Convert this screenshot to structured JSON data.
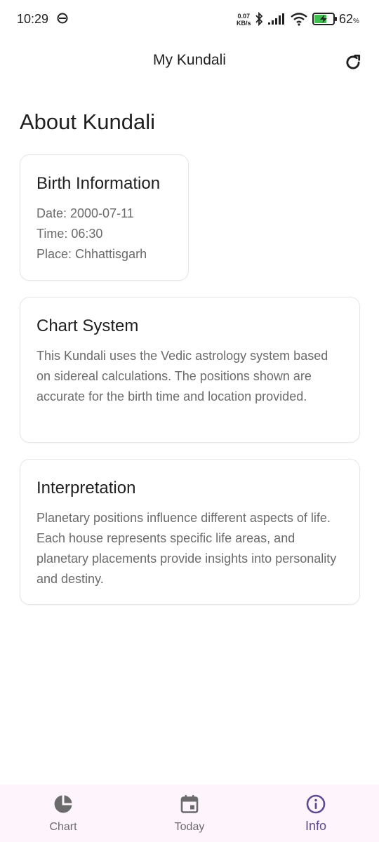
{
  "status_bar": {
    "time": "10:29",
    "net_speed_value": "0.07",
    "net_speed_unit": "KB/s",
    "battery_percent": "62",
    "battery_suffix": "%"
  },
  "app_bar": {
    "title": "My Kundali",
    "refresh_icon": "refresh-icon"
  },
  "page": {
    "heading": "About Kundali"
  },
  "cards": {
    "birth": {
      "title": "Birth Information",
      "date": "Date: 2000-07-11",
      "time": "Time: 06:30",
      "place": "Place: Chhattisgarh"
    },
    "chart_system": {
      "title": "Chart System",
      "body": "This Kundali uses the Vedic astrology system based on sidereal calculations. The positions shown are accurate for the birth time and location provided."
    },
    "interpretation": {
      "title": "Interpretation",
      "body": "Planetary positions influence different aspects of life. Each house represents specific life areas, and planetary placements provide insights into personality and destiny."
    }
  },
  "bottom_nav": {
    "items": [
      {
        "label": "Chart",
        "icon": "pie-chart-icon",
        "active": false
      },
      {
        "label": "Today",
        "icon": "calendar-icon",
        "active": false
      },
      {
        "label": "Info",
        "icon": "info-icon",
        "active": true
      }
    ]
  },
  "colors": {
    "accent": "#5d4a91",
    "nav_background": "#fdf4fc",
    "muted_text": "#6b6b6b"
  }
}
